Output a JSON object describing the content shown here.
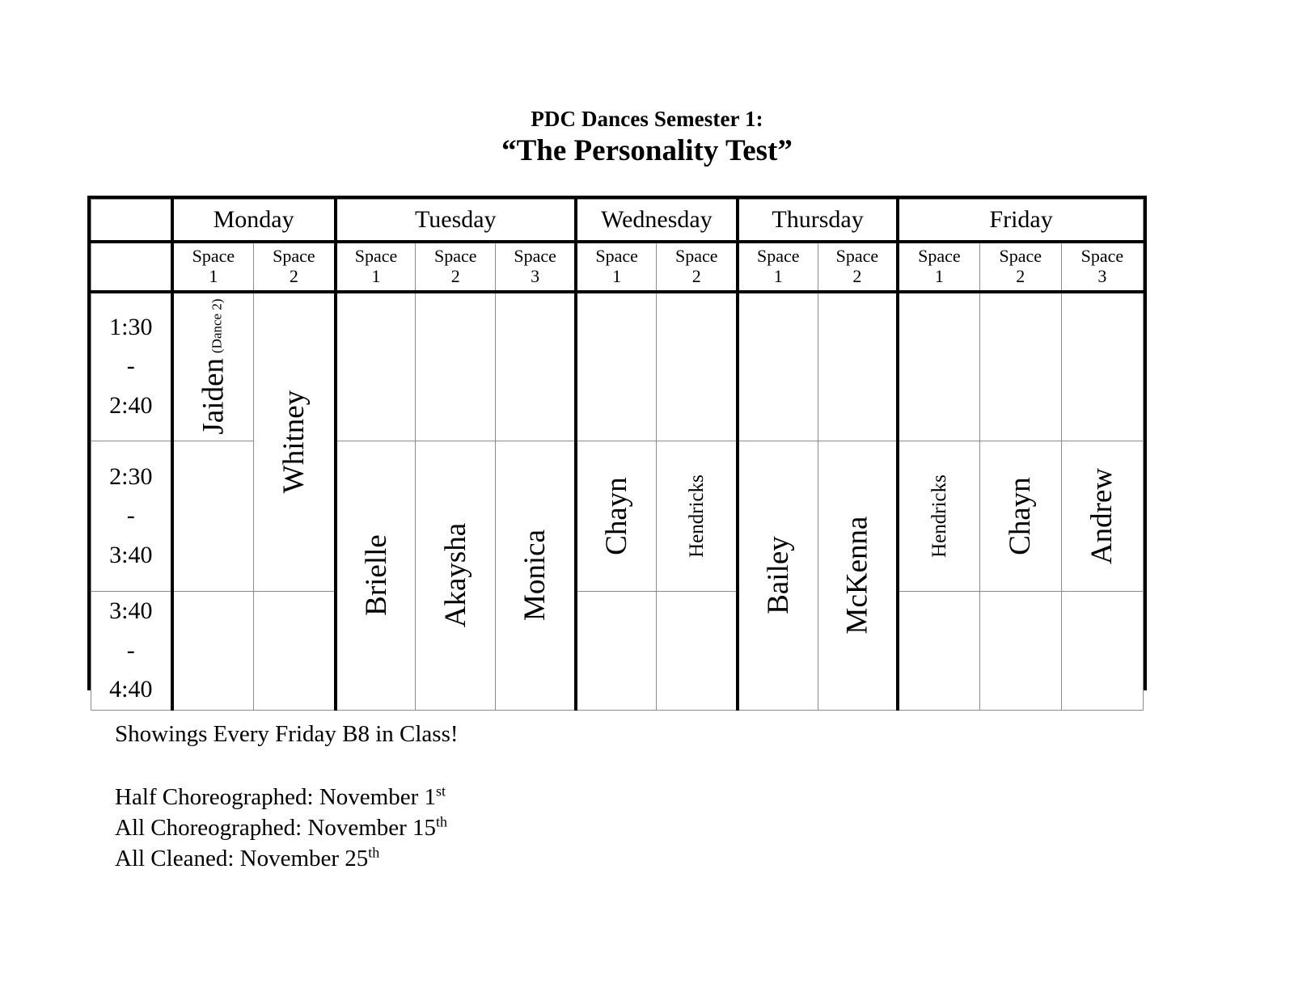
{
  "title": {
    "line1": "PDC Dances Semester 1:",
    "line2": "“The Personality Test”"
  },
  "table": {
    "corner_label": "",
    "days": [
      {
        "name": "Monday",
        "spaces": [
          "Space",
          "Space"
        ]
      },
      {
        "name": "Tuesday",
        "spaces": [
          "Space",
          "Space",
          "Space"
        ]
      },
      {
        "name": "Wednesday",
        "spaces": [
          "Space",
          "Space"
        ]
      },
      {
        "name": "Thursday",
        "spaces": [
          "Space",
          "Space"
        ]
      },
      {
        "name": "Friday",
        "spaces": [
          "Space",
          "Space",
          "Space"
        ]
      }
    ],
    "space_label": "Space",
    "space_numbers": {
      "monday": [
        "1",
        "2"
      ],
      "tuesday": [
        "1",
        "2",
        "3"
      ],
      "wednesday": [
        "1",
        "2"
      ],
      "thursday": [
        "1",
        "2"
      ],
      "friday": [
        "1",
        "2",
        "3"
      ]
    },
    "time_rows": [
      {
        "start": "1:30",
        "dash": "-",
        "end": "2:40",
        "text": "1:30\n-\n2:40"
      },
      {
        "start": "2:30",
        "dash": "-",
        "end": "3:40",
        "text": "2:30\n-\n3:40"
      },
      {
        "start": "3:40",
        "dash": "-",
        "end": "4:40",
        "text": "3:40\n-\n4:40"
      }
    ],
    "entries": {
      "mon_s1_r1_name": "Jaiden",
      "mon_s1_r1_sub": "(Dance 2)",
      "mon_s2_r12": "Whitney",
      "tue_s1_r23": "Brielle",
      "tue_s2_r23": "Akaysha",
      "tue_s3_r23": "Monica",
      "wed_s1_r2": "Chayn",
      "wed_s2_r2": "Hendricks",
      "thu_s1_r23": "Bailey",
      "thu_s2_r23": "McKenna",
      "fri_s1_r2": "Hendricks",
      "fri_s2_r2": "Chayn",
      "fri_s3_r2": "Andrew"
    }
  },
  "notes": {
    "showings": "Showings Every Friday B8 in Class!",
    "half_choreographed_label": "Half Choreographed: November 1",
    "half_choreographed_ord": "st",
    "all_choreographed_label": "All Choreographed: November 15",
    "all_choreographed_ord": "th",
    "all_cleaned_label": "All Cleaned: November 25",
    "all_cleaned_ord": "th"
  },
  "colors": {
    "blocked_dark": "#b1b1b1",
    "blocked_mid": "#c3c3c3",
    "blocked_light": "#cacaca",
    "border": "#000000",
    "background": "#ffffff"
  }
}
